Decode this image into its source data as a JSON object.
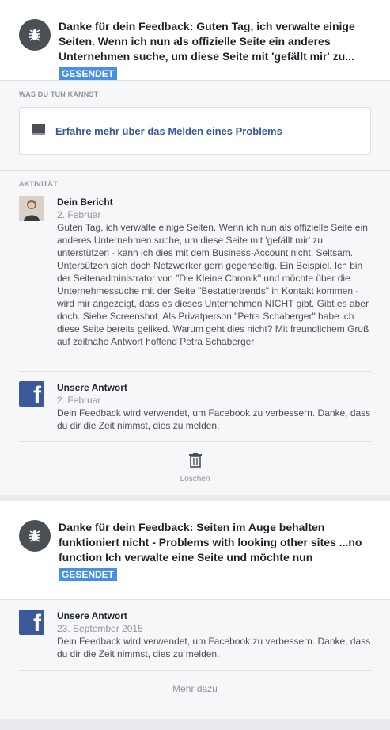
{
  "report1": {
    "title": "Danke für dein Feedback: Guten Tag, ich verwalte einige Seiten. Wenn ich nun als offizielle Seite ein anderes Unternehmen suche, um diese Seite mit 'gefällt mir' zu...",
    "badge": "GESENDET"
  },
  "actions": {
    "label": "WAS DU TUN KANNST",
    "link": "Erfahre mehr über das Melden eines Problems"
  },
  "activity": {
    "label": "AKTIVITÄT",
    "report": {
      "name": "Dein Bericht",
      "date": "2. Februar",
      "text": "Guten Tag, ich verwalte einige Seiten. Wenn ich nun als offizielle Seite ein anderes Unternehmen suche, um diese Seite mit 'gefällt mir' zu unterstützen - kann ich dies mit dem Business-Account nicht. Seltsam. Untersützen sich doch Netzwerker gern gegenseitig. Ein Beispiel. Ich bin der Seitenadministrator von \"Die Kleine Chronik\" und möchte über die Unternehmessuche mit der Seite \"Bestattertrends\" in Kontakt kommen - wird mir angezeigt, dass es dieses Unternehmen NICHT gibt. Gibt es aber doch. Siehe Screenshot. Als Privatperson \"Petra Schaberger\" habe ich diese Seite bereits geliked. Warum geht dies nicht? Mit freundlichem Gruß auf zeitnahe Antwort hoffend Petra Schaberger"
    },
    "answer": {
      "name": "Unsere Antwort",
      "date": "2. Februar",
      "text": "Dein Feedback wird verwendet, um Facebook zu verbessern. Danke, dass du dir die Zeit nimmst, dies zu melden."
    },
    "delete_label": "Löschen"
  },
  "report2": {
    "title": "Danke für dein Feedback: Seiten im Auge behalten funktioniert nicht - Problems with looking other sites ...no function Ich verwalte eine Seite und möchte nun",
    "badge": "GESENDET",
    "answer": {
      "name": "Unsere Antwort",
      "date": "23. September 2015",
      "text": "Dein Feedback wird verwendet, um Facebook zu verbessern. Danke, dass du dir die Zeit nimmst, dies zu melden."
    },
    "more": "Mehr dazu"
  },
  "colors": {
    "badge": "#4a90e2",
    "link": "#365899",
    "facebook": "#3b5998"
  },
  "icons": [
    "bug-icon",
    "book-icon",
    "trash-icon",
    "facebook-logo-icon"
  ]
}
